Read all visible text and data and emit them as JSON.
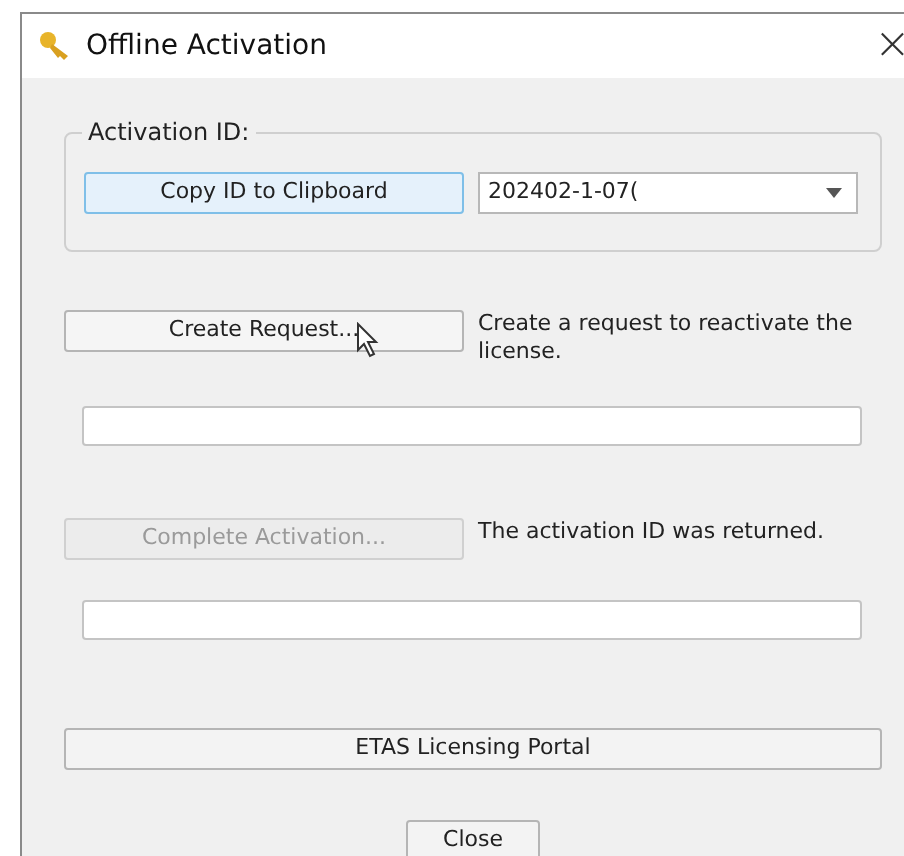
{
  "window": {
    "title": "Offline Activation",
    "close": "×"
  },
  "activation_group": {
    "label": "Activation ID:",
    "copy_button": {
      "label": "Copy ID to Clipboard",
      "focused": true
    },
    "id_combo": {
      "value": "202402-1-07("
    }
  },
  "steps": [
    {
      "button": "Create Request...",
      "disabled": false,
      "hovered": true,
      "description": "Create a request to reactivate the license."
    },
    {
      "button": "Complete Activation...",
      "disabled": true,
      "hovered": false,
      "description": "The activation ID was returned."
    }
  ],
  "portal_button": "ETAS Licensing Portal",
  "close_button": "Close"
}
